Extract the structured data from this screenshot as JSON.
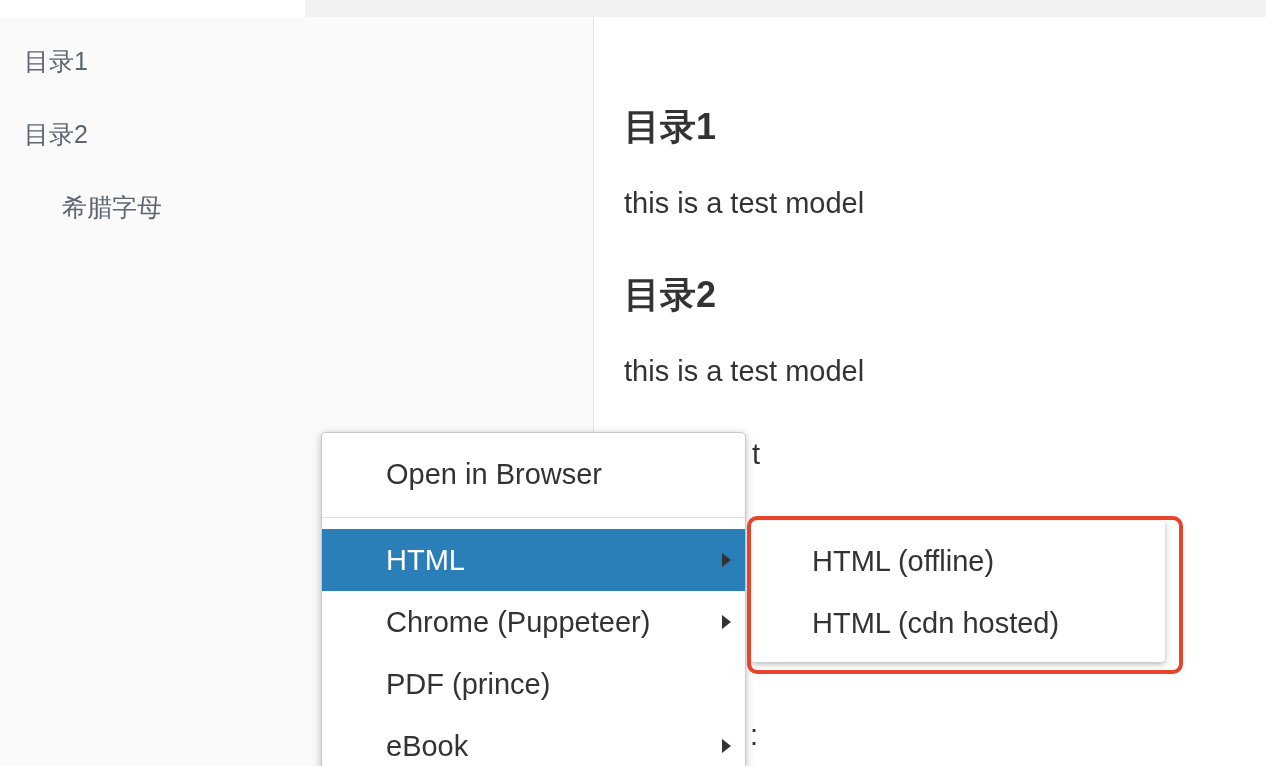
{
  "sidebar": {
    "items": [
      {
        "label": "目录1"
      },
      {
        "label": "目录2",
        "children": [
          {
            "label": "希腊字母"
          }
        ]
      }
    ]
  },
  "content": {
    "sections": [
      {
        "heading": "目录1",
        "text": "this is a test model"
      },
      {
        "heading": "目录2",
        "text": "this is a test model"
      }
    ],
    "fragments": [
      "t",
      ":"
    ]
  },
  "menu": {
    "items": [
      {
        "kind": "item",
        "label": "Open in Browser",
        "selected": false,
        "submenu": false
      },
      {
        "kind": "separator"
      },
      {
        "kind": "item",
        "label": "HTML",
        "selected": true,
        "submenu": true
      },
      {
        "kind": "item",
        "label": "Chrome (Puppeteer)",
        "selected": false,
        "submenu": true
      },
      {
        "kind": "item",
        "label": "PDF (prince)",
        "selected": false,
        "submenu": false
      },
      {
        "kind": "item",
        "label": "eBook",
        "selected": false,
        "submenu": true
      }
    ]
  },
  "submenu": {
    "items": [
      {
        "label": "HTML (offline)",
        "selected": false
      },
      {
        "label": "HTML (cdn hosted)",
        "selected": false
      }
    ]
  }
}
